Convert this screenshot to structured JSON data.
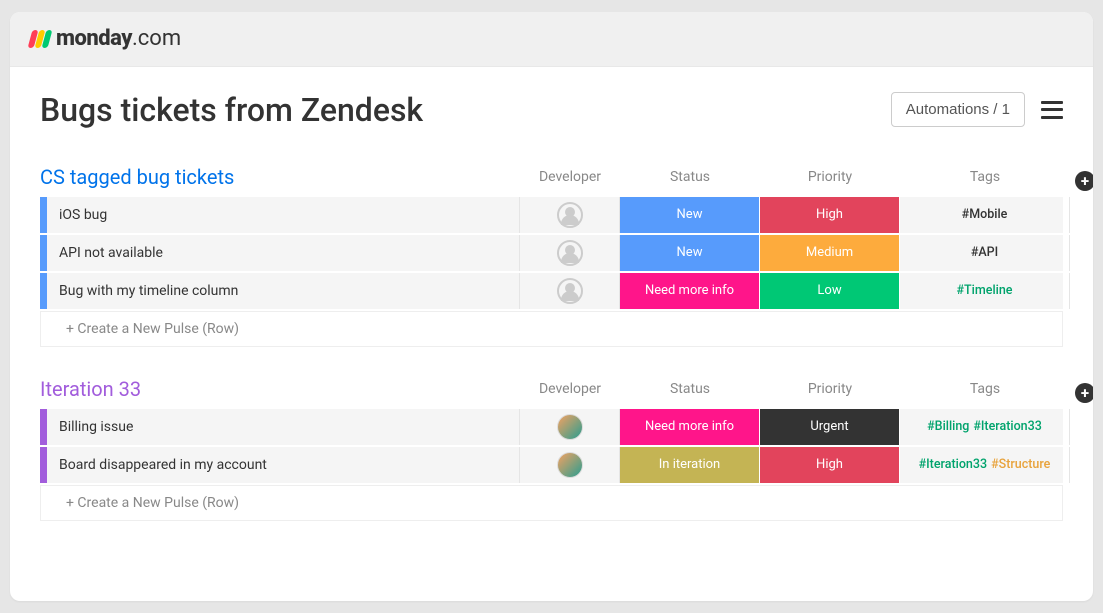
{
  "brand": {
    "name_bold": "monday",
    "name_light": ".com"
  },
  "page": {
    "title": "Bugs tickets from Zendesk"
  },
  "header_actions": {
    "automations_label": "Automations / 1"
  },
  "columns": {
    "developer": "Developer",
    "status": "Status",
    "priority": "Priority",
    "tags": "Tags"
  },
  "new_pulse_label": "+ Create a New Pulse (Row)",
  "groups": [
    {
      "id": "cs",
      "title": "CS tagged bug tickets",
      "color_class": "blue",
      "accent_class": "accent-blue",
      "rows": [
        {
          "name": "iOS bug",
          "developer": null,
          "status": {
            "label": "New",
            "bg": "bg-blue"
          },
          "priority": {
            "label": "High",
            "bg": "bg-red"
          },
          "tags": [
            {
              "text": "#Mobile",
              "cls": ""
            }
          ]
        },
        {
          "name": "API not available",
          "developer": null,
          "status": {
            "label": "New",
            "bg": "bg-blue"
          },
          "priority": {
            "label": "Medium",
            "bg": "bg-orange"
          },
          "tags": [
            {
              "text": "#API",
              "cls": ""
            }
          ]
        },
        {
          "name": "Bug with my timeline column",
          "developer": null,
          "status": {
            "label": "Need more info",
            "bg": "bg-pink"
          },
          "priority": {
            "label": "Low",
            "bg": "bg-green"
          },
          "tags": [
            {
              "text": "#Timeline",
              "cls": "tag-green"
            }
          ]
        }
      ]
    },
    {
      "id": "it33",
      "title": "Iteration 33",
      "color_class": "purple",
      "accent_class": "accent-purple",
      "rows": [
        {
          "name": "Billing issue",
          "developer": "assigned",
          "status": {
            "label": "Need more info",
            "bg": "bg-pink"
          },
          "priority": {
            "label": "Urgent",
            "bg": "bg-dark"
          },
          "tags": [
            {
              "text": "#Billing",
              "cls": "tag-green"
            },
            {
              "text": "#Iteration33",
              "cls": "tag-green"
            }
          ]
        },
        {
          "name": "Board disappeared in my account",
          "developer": "assigned",
          "status": {
            "label": "In iteration",
            "bg": "bg-olive"
          },
          "priority": {
            "label": "High",
            "bg": "bg-red"
          },
          "tags": [
            {
              "text": "#Iteration33",
              "cls": "tag-green"
            },
            {
              "text": "#Structure",
              "cls": "tag-orange"
            }
          ]
        }
      ]
    }
  ]
}
